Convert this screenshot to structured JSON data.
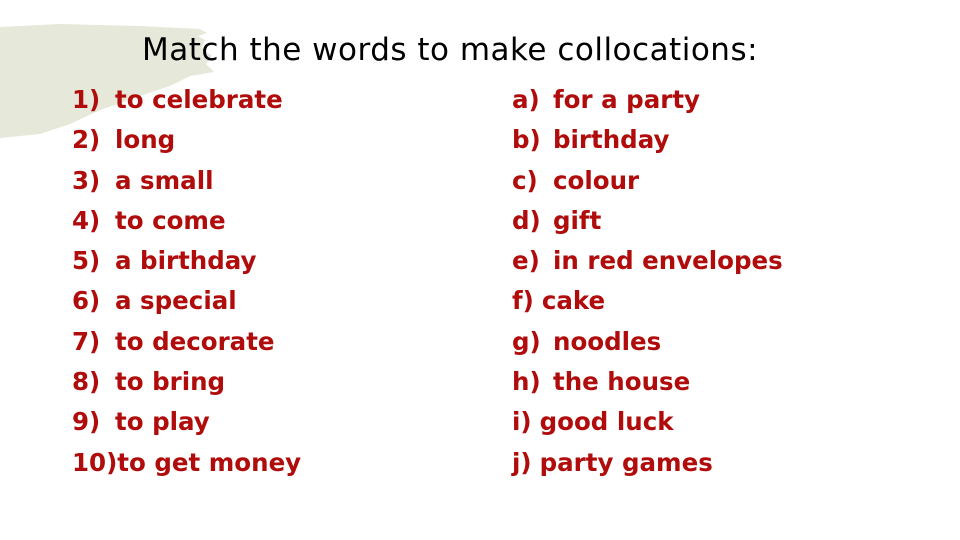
{
  "slide": {
    "title": "Match the words to make collocations:",
    "colors": {
      "title": "#000000",
      "items": "#b10c0c",
      "brush": "#e6e8d9",
      "background": "#ffffff"
    },
    "left_items": [
      {
        "label": "1)",
        "text": "to celebrate"
      },
      {
        "label": "2)",
        "text": "long"
      },
      {
        "label": "3)",
        "text": "a small"
      },
      {
        "label": "4)",
        "text": "to come"
      },
      {
        "label": "5)",
        "text": "a birthday"
      },
      {
        "label": "6)",
        "text": "a special"
      },
      {
        "label": "7)",
        "text": "to decorate"
      },
      {
        "label": "8)",
        "text": "to bring"
      },
      {
        "label": "9)",
        "text": "to play"
      },
      {
        "label": "10)",
        "text": "to get money"
      }
    ],
    "right_items": [
      {
        "label": "a)",
        "text": "for a party"
      },
      {
        "label": "b)",
        "text": "birthday"
      },
      {
        "label": "c)",
        "text": "colour"
      },
      {
        "label": "d)",
        "text": "gift"
      },
      {
        "label": "e)",
        "text": "in red envelopes"
      },
      {
        "label": "f)",
        "text": "cake"
      },
      {
        "label": "g)",
        "text": "noodles"
      },
      {
        "label": "h)",
        "text": "the house"
      },
      {
        "label": "i)",
        "text": "good luck"
      },
      {
        "label": "j)",
        "text": "party games"
      }
    ]
  }
}
